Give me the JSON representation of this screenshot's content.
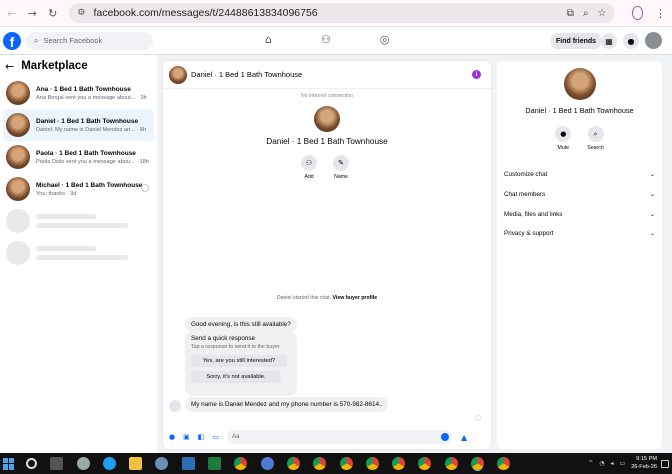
{
  "browser": {
    "back_icon": "arrow-left",
    "forward_icon": "arrow-right",
    "reload_icon": "reload",
    "url": "facebook.com/messages/t/24488613834096756"
  },
  "fb": {
    "search_placeholder": "Search Facebook",
    "find_friends": "Find friends",
    "logo_letter": "f"
  },
  "sidebar": {
    "title": "Marketplace",
    "conversations": [
      {
        "name": "Ana · 1 Bed 1 Bath Townhouse",
        "preview": "Ana Bergal sent you a message about... · 3h"
      },
      {
        "name": "Daniel · 1 Bed 1 Bath Townhouse",
        "preview": "Daniel: My name is Daniel Mendez an... · 8h"
      },
      {
        "name": "Paola · 1 Bed 1 Bath Townhouse",
        "preview": "Paola Dislo sent you a message abou... · 18h"
      },
      {
        "name": "Michael · 1 Bed 1 Bath Townhouse",
        "preview": "You: thanks · 3d"
      }
    ]
  },
  "chat": {
    "header_name": "Daniel · 1 Bed 1 Bath Townhouse",
    "no_connection": "No internet connection",
    "banner_title": "Daniel · 1 Bed 1 Bath Townhouse",
    "actions": [
      {
        "label": "Add"
      },
      {
        "label": "Name"
      }
    ],
    "started_text": "Daniel started this chat.",
    "view_buyer_profile": "View buyer profile",
    "msg1": "Good evening, is this still available?",
    "quick_title": "Send a quick response",
    "quick_subtitle": "Tap a response to send it to the buyer.",
    "quick_options": [
      "Yes, are you still interested?",
      "Sorry, it's not available."
    ],
    "msg2": "My name is Daniel Mendez and my phone number is 570-982-8614..",
    "composer_placeholder": "Aa"
  },
  "right_panel": {
    "title": "Daniel · 1 Bed 1 Bath Townhouse",
    "actions": [
      {
        "label": "Mute"
      },
      {
        "label": "Search"
      }
    ],
    "menu": [
      "Customize chat",
      "Chat members",
      "Media, files and links",
      "Privacy & support"
    ]
  },
  "taskbar": {
    "time": "9:15 PM",
    "date": "26-Feb-26"
  },
  "colors": {
    "brand": "#0866ff",
    "active_conv_bg": "#ebf5ff",
    "info_dot": "#9b30e0"
  }
}
